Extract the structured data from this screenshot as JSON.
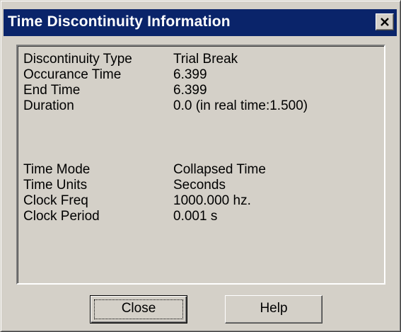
{
  "window": {
    "title": "Time Discontinuity Information",
    "close_glyph": "close-icon"
  },
  "info": {
    "rows": [
      {
        "label": "Discontinuity Type",
        "value": "Trial Break"
      },
      {
        "label": "Occurance Time",
        "value": "6.399"
      },
      {
        "label": "End Time",
        "value": "6.399"
      },
      {
        "label": "Duration",
        "value": "0.0 (in real time:1.500)"
      },
      {
        "label": "Time Mode",
        "value": "Collapsed Time"
      },
      {
        "label": "Time Units",
        "value": "Seconds"
      },
      {
        "label": "Clock Freq",
        "value": "1000.000 hz."
      },
      {
        "label": "Clock Period",
        "value": "0.001 s"
      }
    ]
  },
  "buttons": {
    "close_label": "Close",
    "help_label": "Help"
  },
  "colors": {
    "titlebar": "#0a246a",
    "face": "#d4d0c8"
  }
}
